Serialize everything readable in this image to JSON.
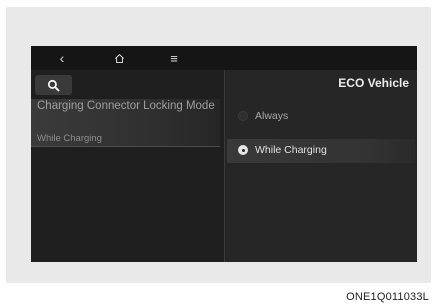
{
  "nav": {
    "back_glyph": "‹",
    "home_icon": "home-icon",
    "menu_glyph": "≡",
    "search_icon": "search-icon"
  },
  "menu": {
    "title": "Charging Connector Locking Mode",
    "value": "While Charging"
  },
  "panel": {
    "title": "ECO Vehicle",
    "options": [
      {
        "label": "Always",
        "selected": false
      },
      {
        "label": "While Charging",
        "selected": true
      }
    ]
  },
  "caption": "ONE1Q011033L"
}
